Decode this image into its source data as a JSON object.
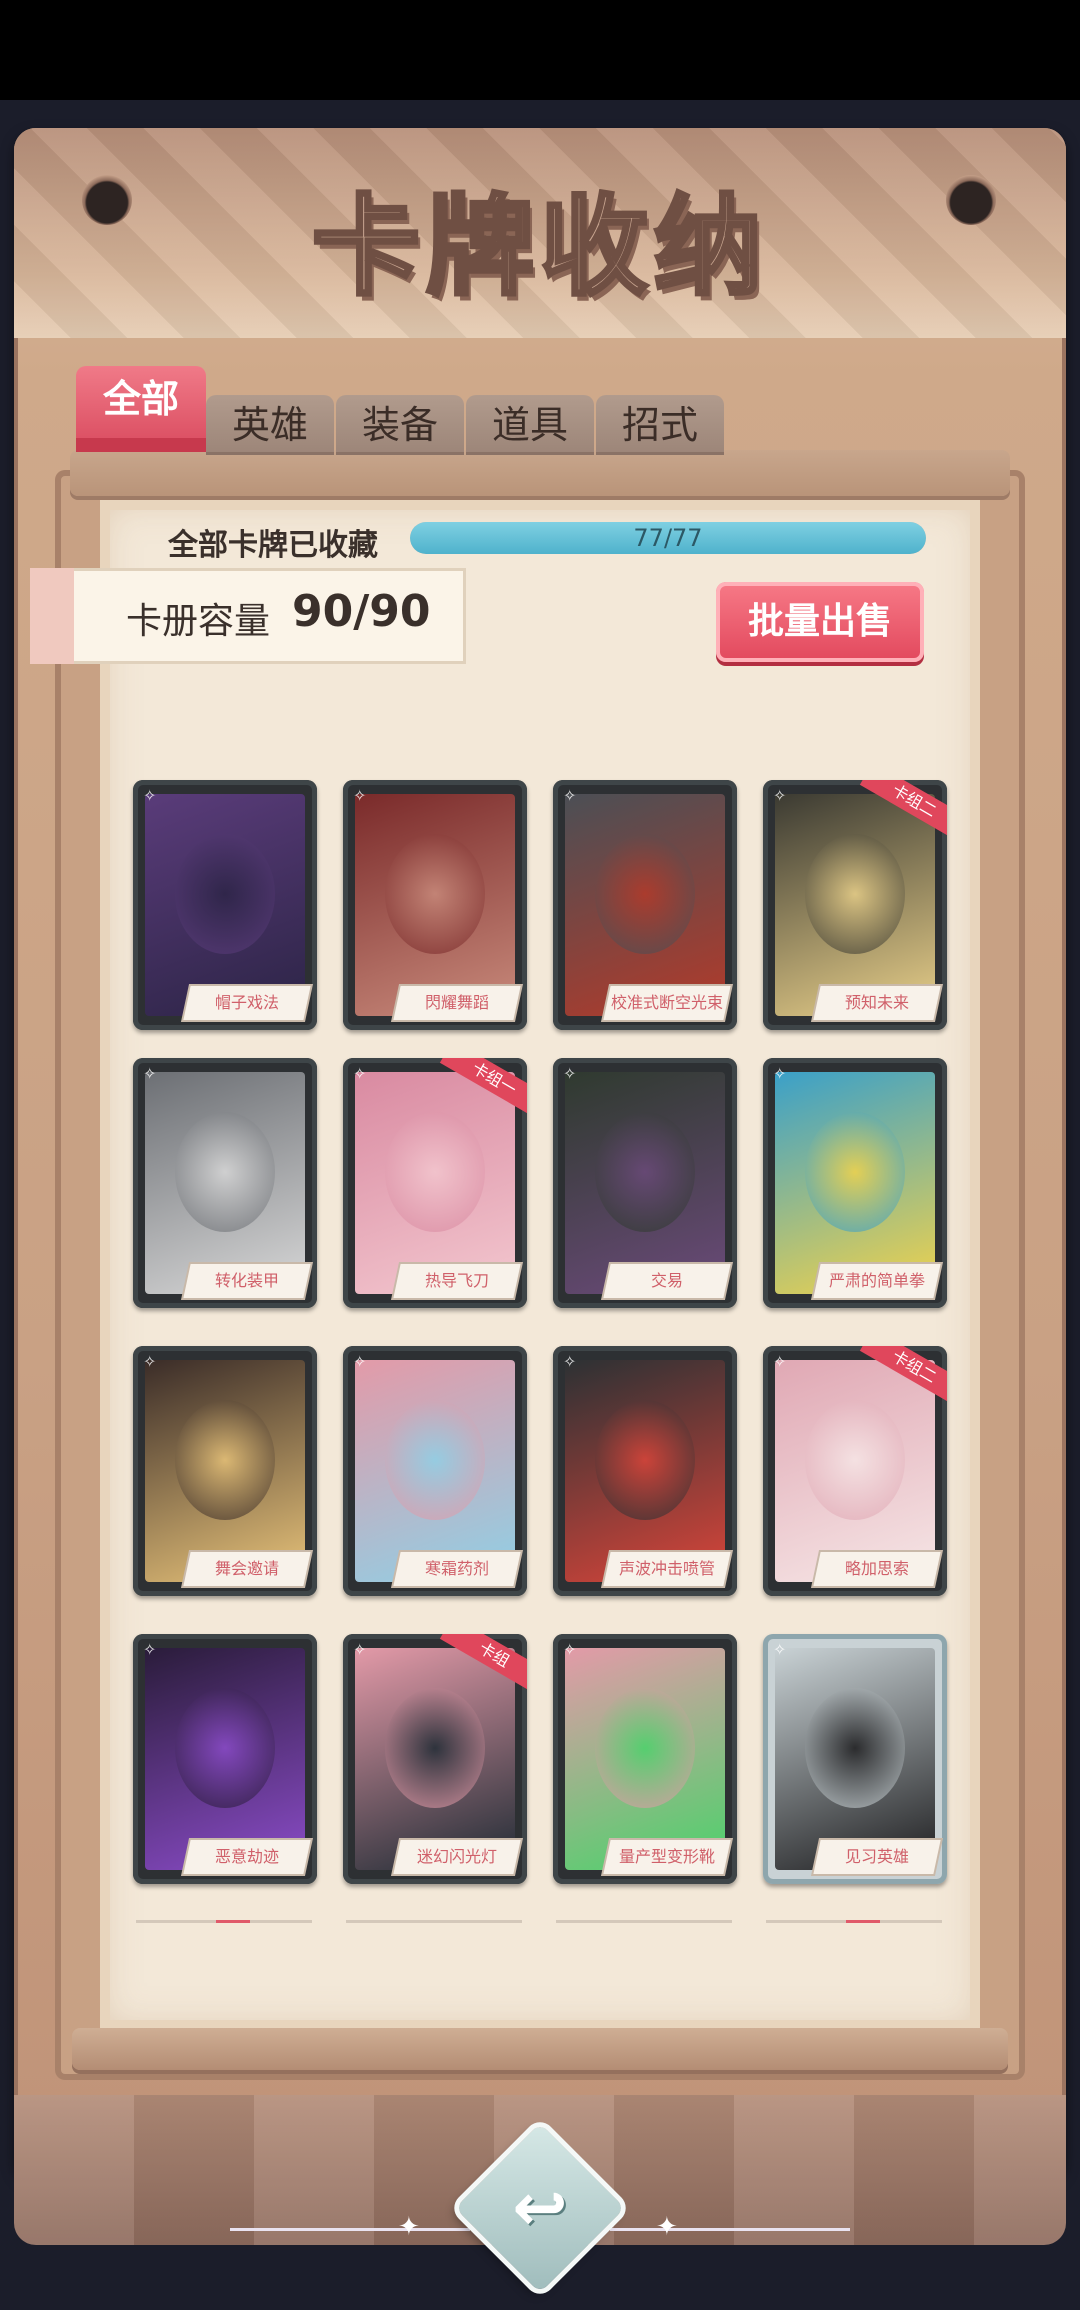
{
  "title": "卡牌收纳",
  "tabs": [
    {
      "label": "全部",
      "active": true
    },
    {
      "label": "英雄",
      "active": false
    },
    {
      "label": "装备",
      "active": false
    },
    {
      "label": "道具",
      "active": false
    },
    {
      "label": "招式",
      "active": false
    }
  ],
  "collection": {
    "label": "全部卡牌已收藏",
    "progress_text": "77/77",
    "progress_fraction": 1.0
  },
  "capacity": {
    "label": "卡册容量",
    "value": "90/90"
  },
  "sell_button": "批量出售",
  "cards": [
    {
      "name": "帽子戏法",
      "ribbon": "",
      "colors": [
        "#5a3c7a",
        "#2c2446"
      ]
    },
    {
      "name": "閃耀舞蹈",
      "ribbon": "",
      "colors": [
        "#7a2a2a",
        "#c98b7c"
      ]
    },
    {
      "name": "校准式断空光束",
      "ribbon": "",
      "colors": [
        "#4b4f55",
        "#b33a2a"
      ]
    },
    {
      "name": "预知未来",
      "ribbon": "卡组二",
      "colors": [
        "#3b3a32",
        "#e9d08a"
      ]
    },
    {
      "name": "转化装甲",
      "ribbon": "",
      "colors": [
        "#6c6f74",
        "#d8d8d8"
      ]
    },
    {
      "name": "热导飞刀",
      "ribbon": "卡组一",
      "colors": [
        "#d98aa1",
        "#f3c7cf"
      ]
    },
    {
      "name": "交易",
      "ribbon": "",
      "colors": [
        "#2f3a2f",
        "#6b4a7a"
      ]
    },
    {
      "name": "严肃的简单拳",
      "ribbon": "",
      "colors": [
        "#3aa0c9",
        "#f2d34b"
      ]
    },
    {
      "name": "舞会邀请",
      "ribbon": "",
      "colors": [
        "#3a2c28",
        "#e9c47a"
      ]
    },
    {
      "name": "寒霜药剂",
      "ribbon": "",
      "colors": [
        "#e39aa8",
        "#8fd0e6"
      ]
    },
    {
      "name": "声波冲击喷管",
      "ribbon": "",
      "colors": [
        "#2c3134",
        "#d9453a"
      ]
    },
    {
      "name": "略加思索",
      "ribbon": "卡组二",
      "colors": [
        "#e0a8b4",
        "#f6e6e6"
      ]
    },
    {
      "name": "恶意劫迹",
      "ribbon": "",
      "colors": [
        "#2a1c3a",
        "#8b4cc9"
      ]
    },
    {
      "name": "迷幻闪光灯",
      "ribbon": "卡组",
      "colors": [
        "#e39aa8",
        "#1e2a33"
      ]
    },
    {
      "name": "量产型变形靴",
      "ribbon": "",
      "colors": [
        "#e39aa8",
        "#49d36a"
      ]
    },
    {
      "name": "见习英雄",
      "ribbon": "",
      "colors": [
        "#c9d2d5",
        "#1d1d1f"
      ],
      "hero": true
    }
  ],
  "back_button": "↩"
}
